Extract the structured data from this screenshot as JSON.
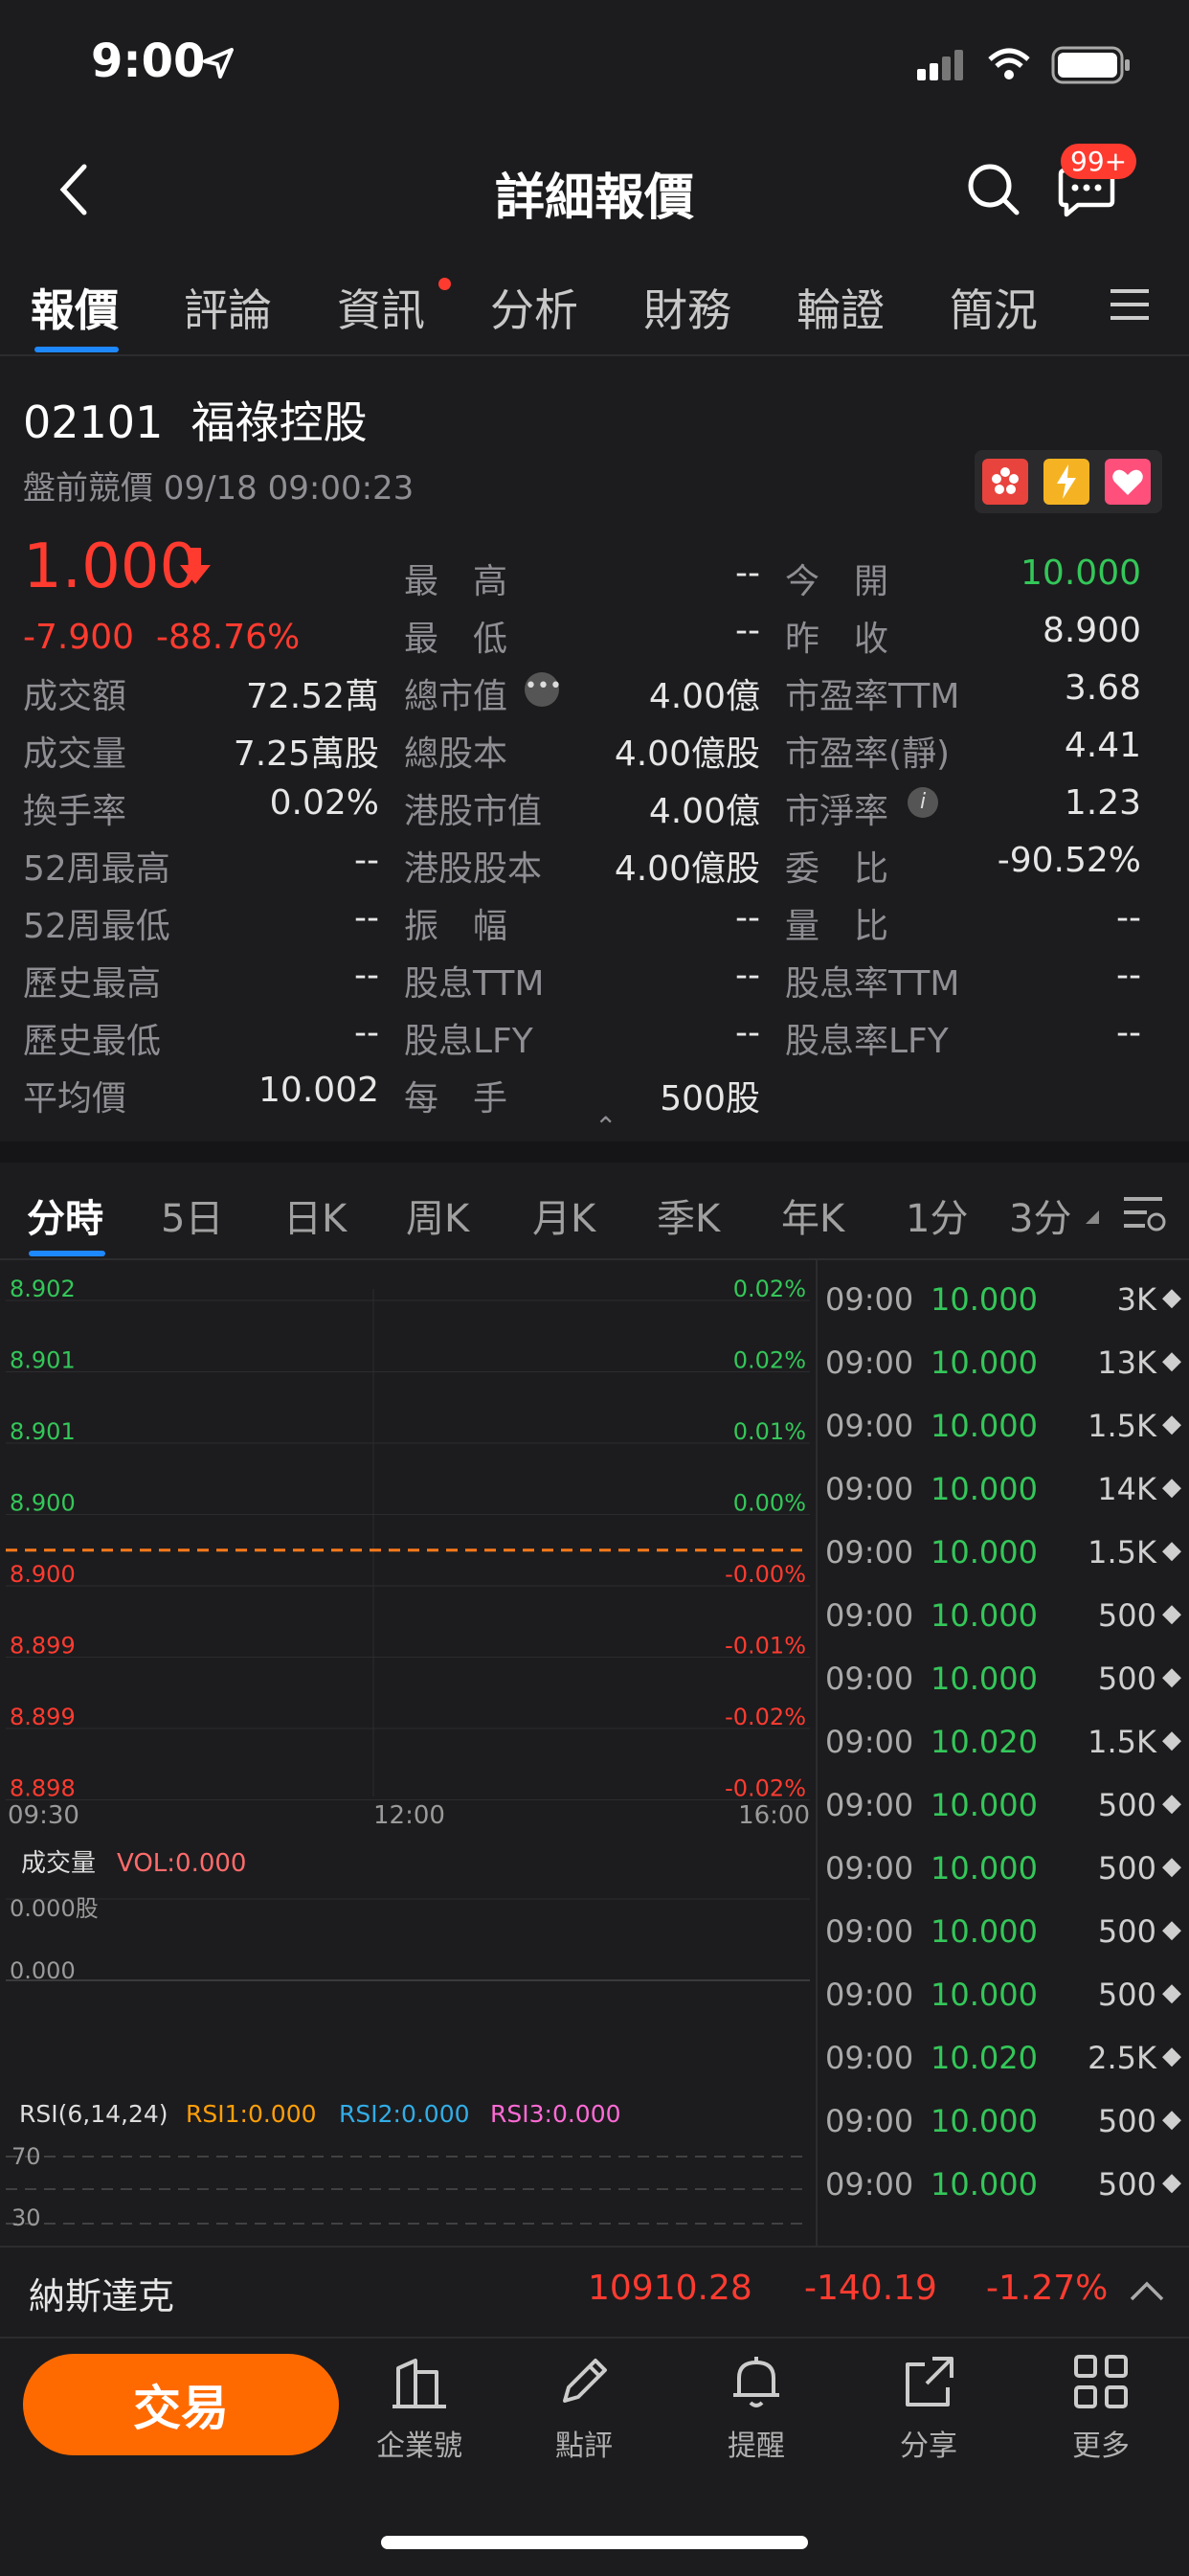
{
  "status": {
    "time": "9:00"
  },
  "nav": {
    "title": "詳細報價",
    "badge": "99+"
  },
  "tabs": [
    "報價",
    "評論",
    "資訊",
    "分析",
    "財務",
    "輪證",
    "簡況"
  ],
  "stock": {
    "code": "02101",
    "name": "福祿控股",
    "session": "盤前競價 09/18 09:00:23",
    "price": "1.000",
    "change": "-7.900",
    "change_pct": "-88.76%"
  },
  "stats": {
    "col1": [
      {
        "label": "成交額",
        "value": "72.52萬"
      },
      {
        "label": "成交量",
        "value": "7.25萬股"
      },
      {
        "label": "換手率",
        "value": "0.02%"
      },
      {
        "label": "52周最高",
        "value": "--"
      },
      {
        "label": "52周最低",
        "value": "--"
      },
      {
        "label": "歷史最高",
        "value": "--"
      },
      {
        "label": "歷史最低",
        "value": "--"
      },
      {
        "label": "平均價",
        "value": "10.002"
      }
    ],
    "col2": [
      {
        "label": "最　高",
        "value": "--"
      },
      {
        "label": "最　低",
        "value": "--"
      },
      {
        "label": "總市值",
        "value": "4.00億"
      },
      {
        "label": "總股本",
        "value": "4.00億股"
      },
      {
        "label": "港股市值",
        "value": "4.00億"
      },
      {
        "label": "港股股本",
        "value": "4.00億股"
      },
      {
        "label": "振　幅",
        "value": "--"
      },
      {
        "label": "股息TTM",
        "value": "--"
      },
      {
        "label": "股息LFY",
        "value": "--"
      },
      {
        "label": "每　手",
        "value": "500股"
      }
    ],
    "col3": [
      {
        "label": "今　開",
        "value": "10.000"
      },
      {
        "label": "昨　收",
        "value": "8.900"
      },
      {
        "label": "市盈率TTM",
        "value": "3.68"
      },
      {
        "label": "市盈率(靜)",
        "value": "4.41"
      },
      {
        "label": "市淨率",
        "value": "1.23"
      },
      {
        "label": "委　比",
        "value": "-90.52%"
      },
      {
        "label": "量　比",
        "value": "--"
      },
      {
        "label": "股息率TTM",
        "value": "--"
      },
      {
        "label": "股息率LFY",
        "value": "--"
      }
    ]
  },
  "chart_tabs": [
    "分時",
    "5日",
    "日K",
    "周K",
    "月K",
    "季K",
    "年K",
    "1分",
    "3分"
  ],
  "chart_data": {
    "type": "line",
    "price_labels": [
      "8.902",
      "8.901",
      "8.901",
      "8.900",
      "8.900",
      "8.899",
      "8.899",
      "8.898"
    ],
    "pct_labels": [
      "0.02%",
      "0.02%",
      "0.01%",
      "0.00%",
      "-0.00%",
      "-0.01%",
      "-0.02%",
      "-0.02%"
    ],
    "x_ticks": [
      "09:30",
      "12:00",
      "16:00"
    ],
    "prev_close": 8.9,
    "volume_label": "成交量",
    "volume_value": "VOL:0.000",
    "volume_axis": [
      "0.000股",
      "0.000"
    ],
    "rsi": {
      "label": "RSI(6,14,24)",
      "rsi1": "RSI1:0.000",
      "rsi2": "RSI2:0.000",
      "rsi3": "RSI3:0.000",
      "levels": [
        "70",
        "30"
      ]
    },
    "colors": {
      "up": "#34c759",
      "down": "#ff3b30",
      "prev_close_line": "#ff7a1a",
      "rsi1": "#ff9f0a",
      "rsi2": "#32ade6",
      "rsi3": "#ff6bd6"
    }
  },
  "trades": [
    {
      "time": "09:00",
      "price": "10.000",
      "vol": "3K"
    },
    {
      "time": "09:00",
      "price": "10.000",
      "vol": "13K"
    },
    {
      "time": "09:00",
      "price": "10.000",
      "vol": "1.5K"
    },
    {
      "time": "09:00",
      "price": "10.000",
      "vol": "14K"
    },
    {
      "time": "09:00",
      "price": "10.000",
      "vol": "1.5K"
    },
    {
      "time": "09:00",
      "price": "10.000",
      "vol": "500"
    },
    {
      "time": "09:00",
      "price": "10.000",
      "vol": "500"
    },
    {
      "time": "09:00",
      "price": "10.020",
      "vol": "1.5K"
    },
    {
      "time": "09:00",
      "price": "10.000",
      "vol": "500"
    },
    {
      "time": "09:00",
      "price": "10.000",
      "vol": "500"
    },
    {
      "time": "09:00",
      "price": "10.000",
      "vol": "500"
    },
    {
      "time": "09:00",
      "price": "10.000",
      "vol": "500"
    },
    {
      "time": "09:00",
      "price": "10.020",
      "vol": "2.5K"
    },
    {
      "time": "09:00",
      "price": "10.000",
      "vol": "500"
    },
    {
      "time": "09:00",
      "price": "10.000",
      "vol": "500"
    }
  ],
  "index_bar": {
    "name": "納斯達克",
    "value": "10910.28",
    "change": "-140.19",
    "pct": "-1.27%"
  },
  "actions": {
    "trade": "交易",
    "items": [
      "企業號",
      "點評",
      "提醒",
      "分享",
      "更多"
    ]
  }
}
